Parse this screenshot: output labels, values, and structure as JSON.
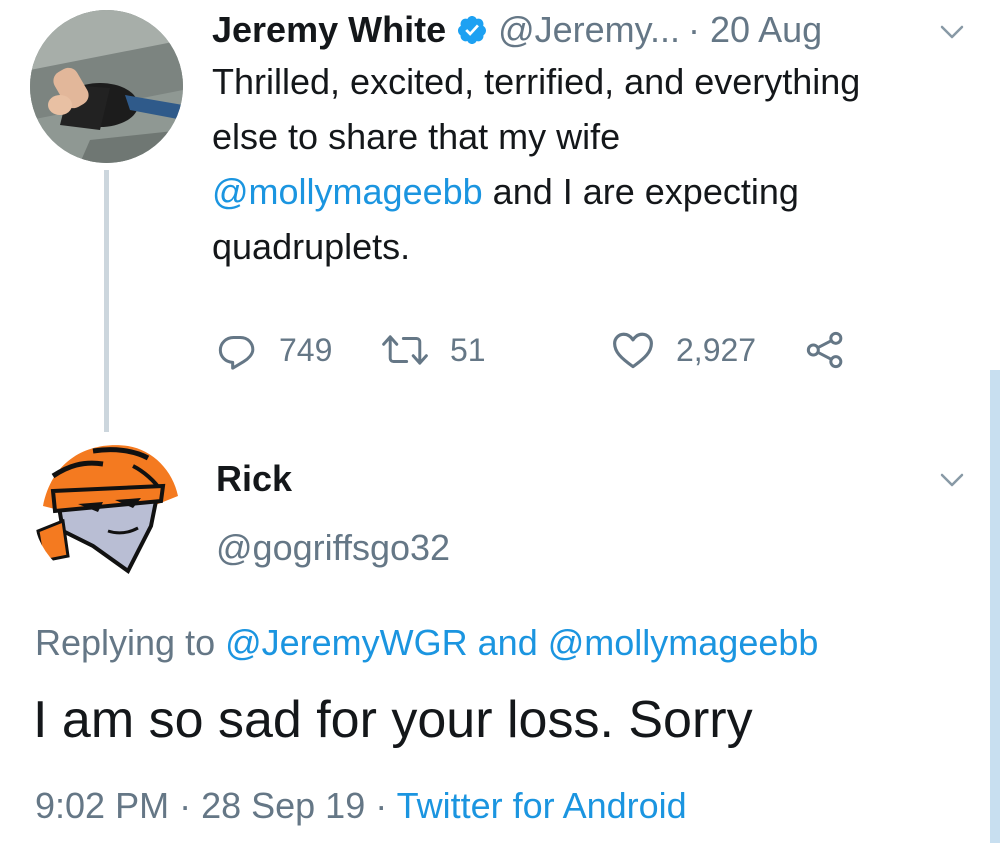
{
  "tweet": {
    "author_name": "Jeremy White",
    "handle": "@Jeremy...",
    "separator": "·",
    "date": "20 Aug",
    "text_line1": "Thrilled, excited, terrified, and everything",
    "text_line2": "else to share that my wife",
    "mention": "@mollymageebb",
    "text_line3_rest": " and I are expecting",
    "text_line4": "quadruplets.",
    "replies_count": "749",
    "retweets_count": "51",
    "likes_count": "2,927"
  },
  "reply": {
    "author_name": "Rick",
    "handle": "@gogriffsgo32",
    "replying_label": "Replying to ",
    "replying_to_1": "@JeremyWGR",
    "replying_and": " and ",
    "replying_to_2": "@mollymageebb",
    "text": "I am so sad for your loss. Sorry",
    "time": "9:02 PM",
    "separator1": " · ",
    "date": "28 Sep 19",
    "separator2": " · ",
    "source": "Twitter for Android"
  },
  "colors": {
    "link_blue": "#1b95e0",
    "muted_gray": "#657786",
    "text": "#14171a"
  },
  "icons": [
    "verified-badge-icon",
    "chevron-down-icon",
    "reply-icon",
    "retweet-icon",
    "like-icon",
    "share-icon"
  ]
}
